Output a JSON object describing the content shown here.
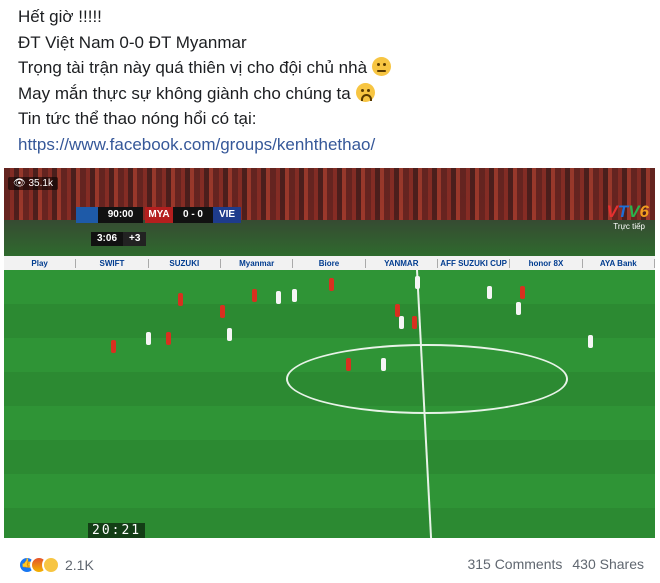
{
  "post": {
    "line1": "Hết giờ !!!!!",
    "line2": "ĐT Việt Nam 0-0 ĐT Myanmar",
    "line3": "Trọng tài trận này quá thiên vị cho đội chủ nhà",
    "line3_emoji": "neutral-face-emoji",
    "line4": "May mắn thực sự không giành cho chúng ta",
    "line4_emoji": "sad-face-emoji",
    "line5": "Tin tức thể thao nóng hổi có tại:",
    "link": "https://www.facebook.com/groups/kenhthethao/"
  },
  "video": {
    "views": "35.1k",
    "view_icon": "eye-icon",
    "scoreboard": {
      "time": "90:00",
      "team1": "MYA",
      "score": "0 - 0",
      "team2": "VIE",
      "added_clock": "3:06",
      "added_time": "+3"
    },
    "broadcaster": [
      "V",
      "T",
      "V",
      "6"
    ],
    "broadcaster_sub": "Trực tiếp",
    "clock": "20:21",
    "adboard": [
      "Play",
      "SWIFT",
      "SUZUKI",
      "Myanmar",
      "Biore",
      "YANMAR",
      "AFF SUZUKI CUP",
      "honor 8X",
      "AYA Bank"
    ],
    "colors": {
      "home_kit": "#d8301f",
      "away_kit": "#f5f5f5",
      "pitch": "#2f9436"
    }
  },
  "footer": {
    "reaction_icons": [
      "like-icon",
      "angry-icon",
      "sad-icon"
    ],
    "reaction_count": "2.1K",
    "comments": "315 Comments",
    "shares": "430 Shares"
  }
}
